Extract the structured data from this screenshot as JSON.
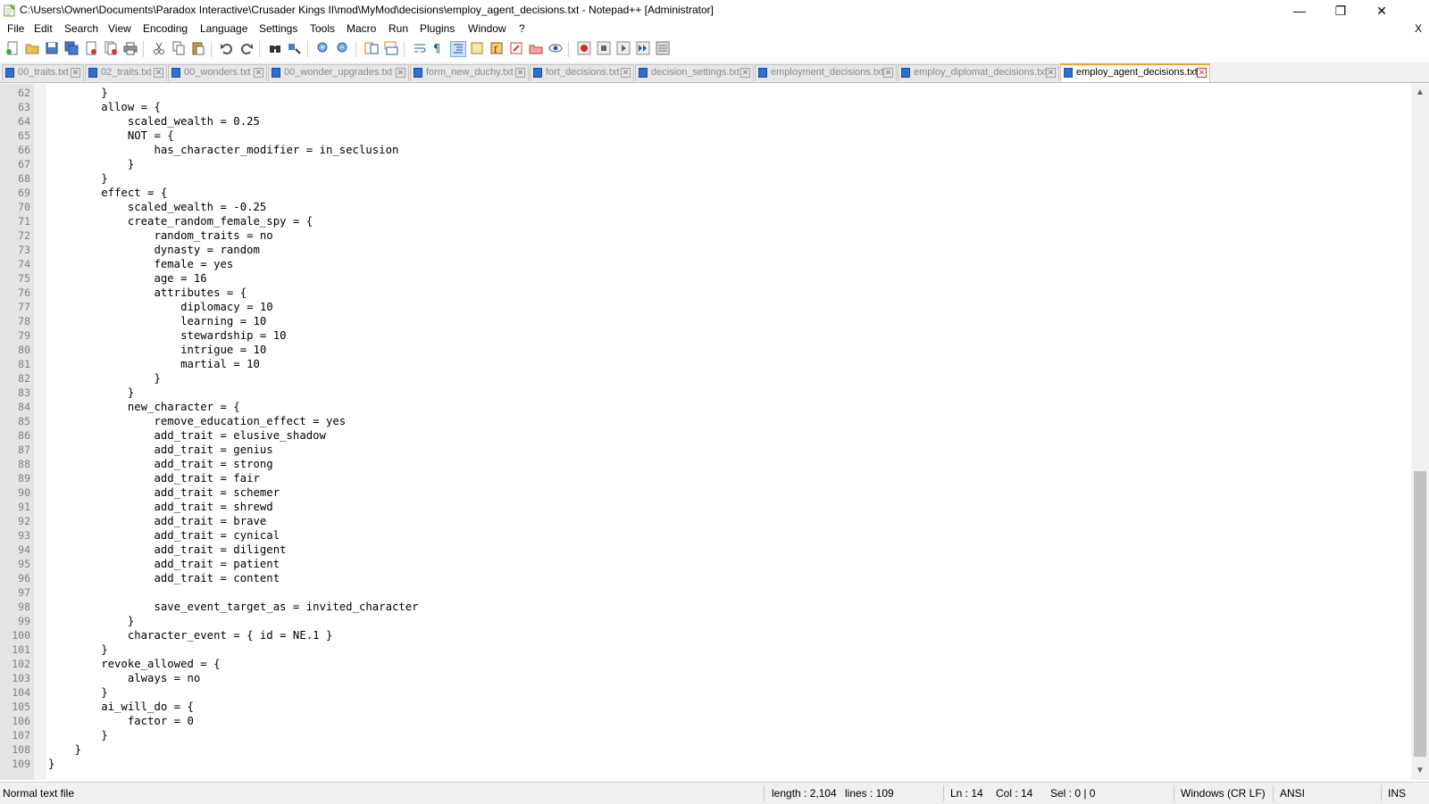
{
  "window": {
    "title": "C:\\Users\\Owner\\Documents\\Paradox Interactive\\Crusader Kings II\\mod\\MyMod\\decisions\\employ_agent_decisions.txt - Notepad++ [Administrator]",
    "min_glyph": "—",
    "max_glyph": "❐",
    "close_glyph": "✕"
  },
  "menu": {
    "items": [
      "File",
      "Edit",
      "Search",
      "View",
      "Encoding",
      "Language",
      "Settings",
      "Tools",
      "Macro",
      "Run",
      "Plugins",
      "Window",
      "?"
    ],
    "close_doc": "X"
  },
  "toolbar": {
    "buttons": [
      "new",
      "open",
      "save",
      "save-all",
      "close",
      "close-all",
      "print",
      "cut",
      "copy",
      "paste",
      "undo",
      "redo",
      "find",
      "replace",
      "zoom-in",
      "zoom-out",
      "sync-vertical",
      "sync-horizontal",
      "word-wrap",
      "show-all-chars",
      "indent-guide",
      "doc-map",
      "function-list",
      "folder-workspace",
      "monitoring",
      "record-macro",
      "stop-macro",
      "play-macro",
      "run-macro-multiple",
      "save-macro"
    ]
  },
  "tabs": [
    {
      "label": "00_traits.txt",
      "active": false
    },
    {
      "label": "02_traits.txt",
      "active": false
    },
    {
      "label": "00_wonders.txt",
      "active": false
    },
    {
      "label": "00_wonder_upgrades.txt",
      "active": false
    },
    {
      "label": "form_new_duchy.txt",
      "active": false
    },
    {
      "label": "fort_decisions.txt",
      "active": false
    },
    {
      "label": "decision_settings.txt",
      "active": false
    },
    {
      "label": "employment_decisions.txt",
      "active": false
    },
    {
      "label": "employ_diplomat_decisions.txt",
      "active": false
    },
    {
      "label": "employ_agent_decisions.txt",
      "active": true
    }
  ],
  "editor": {
    "lines": [
      {
        "n": "62",
        "t": "        }"
      },
      {
        "n": "63",
        "t": "        allow = {"
      },
      {
        "n": "64",
        "t": "            scaled_wealth = 0.25"
      },
      {
        "n": "65",
        "t": "            NOT = {"
      },
      {
        "n": "66",
        "t": "                has_character_modifier = in_seclusion"
      },
      {
        "n": "67",
        "t": "            }"
      },
      {
        "n": "68",
        "t": "        }"
      },
      {
        "n": "69",
        "t": "        effect = {"
      },
      {
        "n": "70",
        "t": "            scaled_wealth = -0.25"
      },
      {
        "n": "71",
        "t": "            create_random_female_spy = {"
      },
      {
        "n": "72",
        "t": "                random_traits = no"
      },
      {
        "n": "73",
        "t": "                dynasty = random"
      },
      {
        "n": "74",
        "t": "                female = yes"
      },
      {
        "n": "75",
        "t": "                age = 16"
      },
      {
        "n": "76",
        "t": "                attributes = {"
      },
      {
        "n": "77",
        "t": "                    diplomacy = 10"
      },
      {
        "n": "78",
        "t": "                    learning = 10"
      },
      {
        "n": "79",
        "t": "                    stewardship = 10"
      },
      {
        "n": "80",
        "t": "                    intrigue = 10"
      },
      {
        "n": "81",
        "t": "                    martial = 10"
      },
      {
        "n": "82",
        "t": "                }"
      },
      {
        "n": "83",
        "t": "            }"
      },
      {
        "n": "84",
        "t": "            new_character = {"
      },
      {
        "n": "85",
        "t": "                remove_education_effect = yes"
      },
      {
        "n": "86",
        "t": "                add_trait = elusive_shadow"
      },
      {
        "n": "87",
        "t": "                add_trait = genius"
      },
      {
        "n": "88",
        "t": "                add_trait = strong"
      },
      {
        "n": "89",
        "t": "                add_trait = fair"
      },
      {
        "n": "90",
        "t": "                add_trait = schemer"
      },
      {
        "n": "91",
        "t": "                add_trait = shrewd"
      },
      {
        "n": "92",
        "t": "                add_trait = brave"
      },
      {
        "n": "93",
        "t": "                add_trait = cynical"
      },
      {
        "n": "94",
        "t": "                add_trait = diligent"
      },
      {
        "n": "95",
        "t": "                add_trait = patient"
      },
      {
        "n": "96",
        "t": "                add_trait = content"
      },
      {
        "n": "97",
        "t": ""
      },
      {
        "n": "98",
        "t": "                save_event_target_as = invited_character"
      },
      {
        "n": "99",
        "t": "            }"
      },
      {
        "n": "100",
        "t": "            character_event = { id = NE.1 }"
      },
      {
        "n": "101",
        "t": "        }"
      },
      {
        "n": "102",
        "t": "        revoke_allowed = {"
      },
      {
        "n": "103",
        "t": "            always = no"
      },
      {
        "n": "104",
        "t": "        }"
      },
      {
        "n": "105",
        "t": "        ai_will_do = {"
      },
      {
        "n": "106",
        "t": "            factor = 0"
      },
      {
        "n": "107",
        "t": "        }"
      },
      {
        "n": "108",
        "t": "    }"
      },
      {
        "n": "109",
        "t": "}"
      }
    ]
  },
  "status": {
    "file_type": "Normal text file",
    "length": "length : 2,104",
    "lines": "lines : 109",
    "ln": "Ln : 14",
    "col": "Col : 14",
    "sel": "Sel : 0 | 0",
    "eol": "Windows (CR LF)",
    "encoding": "ANSI",
    "mode": "INS"
  },
  "colors": {
    "accent_tab": "#f0a030",
    "file_icon": "#2d6fd2",
    "gutter_bg": "#e4e4e4",
    "line_number": "#808080"
  }
}
